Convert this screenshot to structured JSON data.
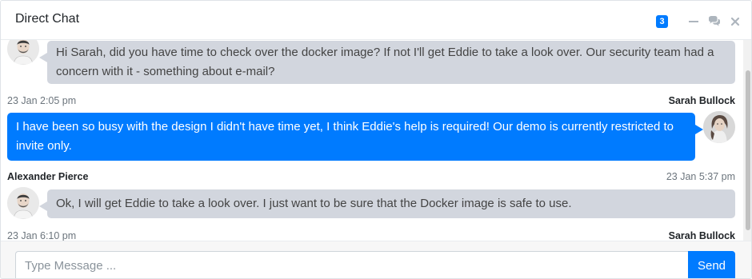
{
  "header": {
    "title": "Direct Chat",
    "badge_count": "3",
    "icons": [
      "minus-icon",
      "comments-icon",
      "close-icon"
    ]
  },
  "messages": [
    {
      "side": "left",
      "name": "",
      "time": "",
      "avatar": "alexander-pierce-avatar",
      "text": "Hi Sarah, did you have time to check over the docker image? If not I'll get Eddie to take a look over. Our security team had a concern with it - something about e-mail?"
    },
    {
      "side": "right",
      "name": "Sarah Bullock",
      "time": "23 Jan 2:05 pm",
      "avatar": "sarah-bullock-avatar",
      "text": "I have been so busy with the design I didn't have time yet, I think Eddie's help is required! Our demo is currently restricted to invite only."
    },
    {
      "side": "left",
      "name": "Alexander Pierce",
      "time": "23 Jan 5:37 pm",
      "avatar": "alexander-pierce-avatar",
      "text": "Ok, I will get Eddie to take a look over. I just want to be sure that the Docker image is safe to use."
    },
    {
      "side": "right",
      "name": "Sarah Bullock",
      "time": "23 Jan 6:10 pm",
      "avatar": "sarah-bullock-avatar",
      "text": ""
    }
  ],
  "footer": {
    "input_placeholder": "Type Message ...",
    "input_value": "",
    "send_label": "Send"
  },
  "colors": {
    "primary": "#007bff",
    "left_bubble": "#d2d6de"
  }
}
